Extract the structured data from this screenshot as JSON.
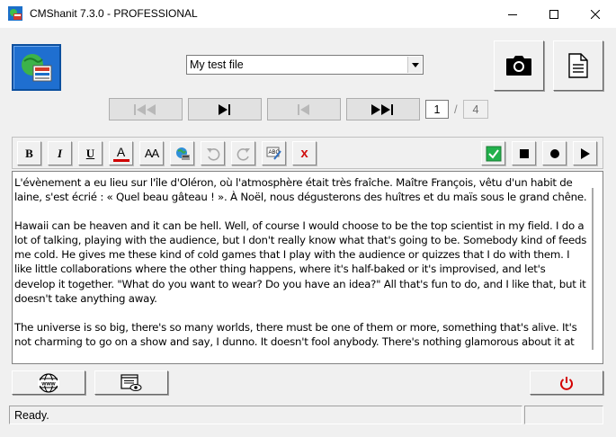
{
  "window": {
    "title": "CMShanit  7.3.0  -  PROFESSIONAL"
  },
  "file_select": {
    "selected": "My test file"
  },
  "pager": {
    "current_page": "1",
    "separator": "/",
    "total_pages": "4"
  },
  "toolbar": {
    "bold_label": "B",
    "italic_label": "I",
    "underline_label": "U",
    "font_color_label": "A",
    "font_size_label": "AA",
    "delete_label": "x"
  },
  "editor": {
    "paragraphs": [
      "L'évènement a eu lieu sur l'île d'Oléron, où l'atmosphère était très fraîche. Maître François, vêtu d'un habit de laine, s'est écrié : « Quel beau gâteau ! ». À Noël, nous dégusterons des huîtres et du maïs sous le grand chêne.",
      "Hawaii can be heaven and it can be hell. Well, of course I would choose to be the top scientist in my field. I do a lot of talking, playing with the audience, but I don't really know what that's going to be. Somebody kind of feeds me cold. He gives me these kind of cold games that I play with the audience or quizzes that I do with them. I like little collaborations where the other thing happens, where it's half-baked or it's improvised, and let's develop it together. \"What do you want to wear? Do you have an idea?\" All that's fun to do, and I like that, but it doesn't take anything away.",
      "The universe is so big, there's so many worlds, there must be one of them or more, something that's alive. It's not charming to go on a show and say, I dunno. It doesn't fool anybody. There's nothing glamorous about it at"
    ]
  },
  "status": {
    "text": "Ready."
  },
  "colors": {
    "power_red": "#d40000",
    "check_green": "#22b14c",
    "delete_red": "#d01010",
    "font_color_red": "#d00000"
  },
  "icons": [
    "app-icon",
    "minimize-icon",
    "maximize-icon",
    "close-icon",
    "camera-icon",
    "document-icon",
    "first-page-icon",
    "next-page-icon",
    "previous-page-icon",
    "last-page-icon",
    "globe-icon",
    "undo-icon",
    "redo-icon",
    "spellcheck-icon",
    "checkbox-icon",
    "stop-icon",
    "record-icon",
    "play-icon",
    "www-icon",
    "preview-icon",
    "power-icon"
  ]
}
